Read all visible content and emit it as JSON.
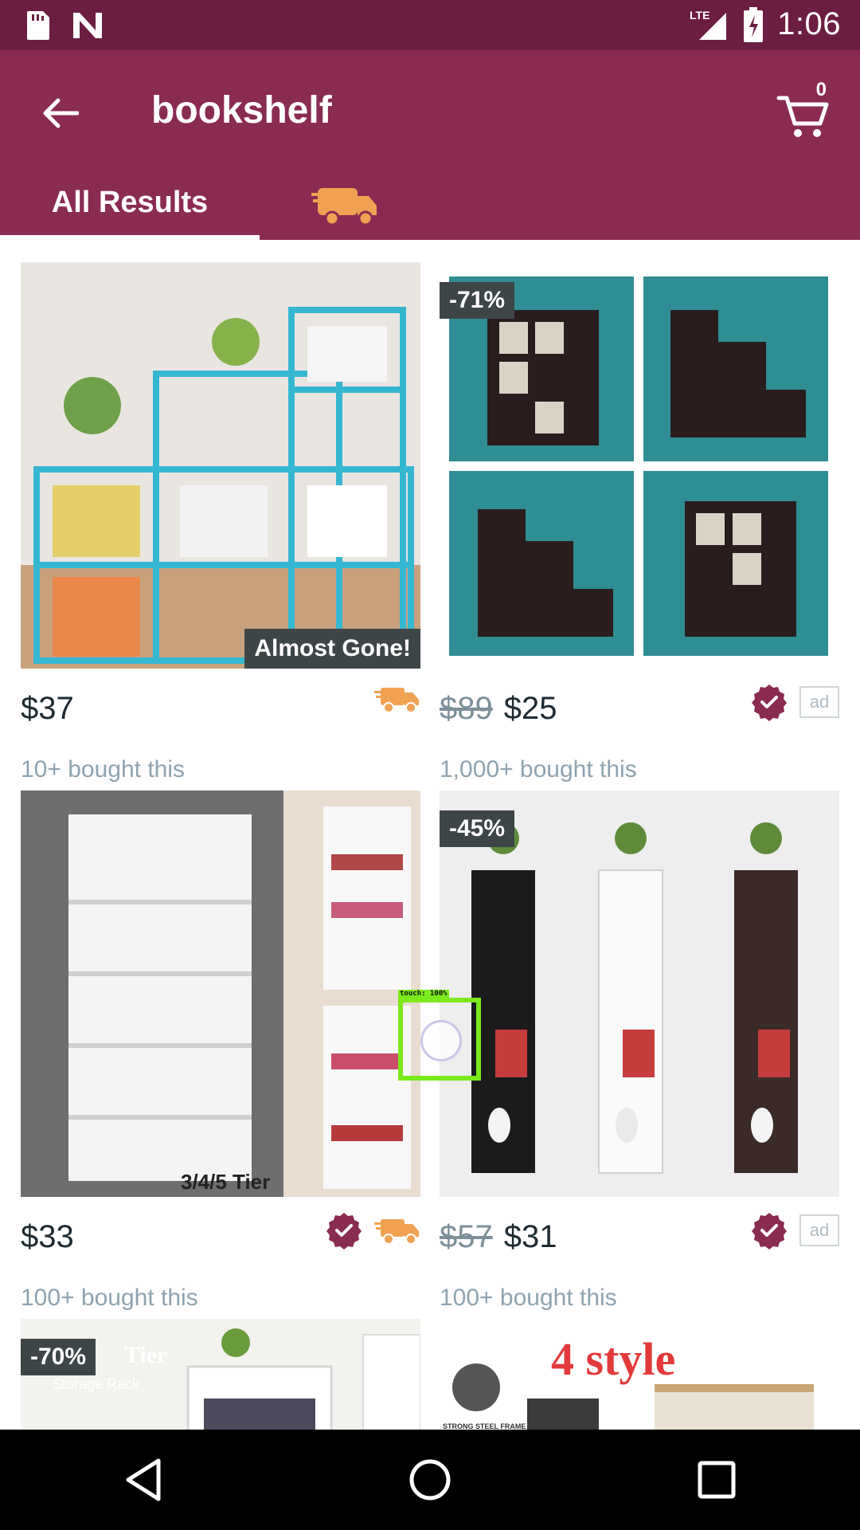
{
  "status": {
    "time": "1:06",
    "network": "LTE"
  },
  "appbar": {
    "title": "bookshelf",
    "cart_count": "0"
  },
  "tabs": {
    "all": "All Results"
  },
  "products": [
    {
      "price": "$37",
      "old_price": "",
      "bought": "10+ bought this",
      "badge": "",
      "label": "Almost Gone!",
      "verified": false,
      "fast_ship": true,
      "ad": false
    },
    {
      "price": "$25",
      "old_price": "$89",
      "bought": "1,000+ bought this",
      "badge": "-71%",
      "label": "",
      "verified": true,
      "fast_ship": false,
      "ad": true
    },
    {
      "price": "$33",
      "old_price": "",
      "bought": "100+ bought this",
      "badge": "",
      "label": "3/4/5 Tier",
      "verified": true,
      "fast_ship": true,
      "ad": false
    },
    {
      "price": "$31",
      "old_price": "$57",
      "bought": "100+ bought this",
      "badge": "-45%",
      "label": "",
      "verified": true,
      "fast_ship": false,
      "ad": true
    },
    {
      "badge": "-70%",
      "image_text": "Tier",
      "image_subtext": "Storage Rack"
    },
    {
      "image_text": "4 style",
      "image_subtext": "STRONG STEEL FRAME"
    }
  ],
  "ad_label": "ad",
  "overlay": {
    "label": "touch: 100%"
  },
  "colors": {
    "status_bar": "#6b1e41",
    "app_bar": "#8a2b52",
    "badge": "#3d4547",
    "accent_orange": "#f0a252",
    "verified": "#8a2b52"
  }
}
